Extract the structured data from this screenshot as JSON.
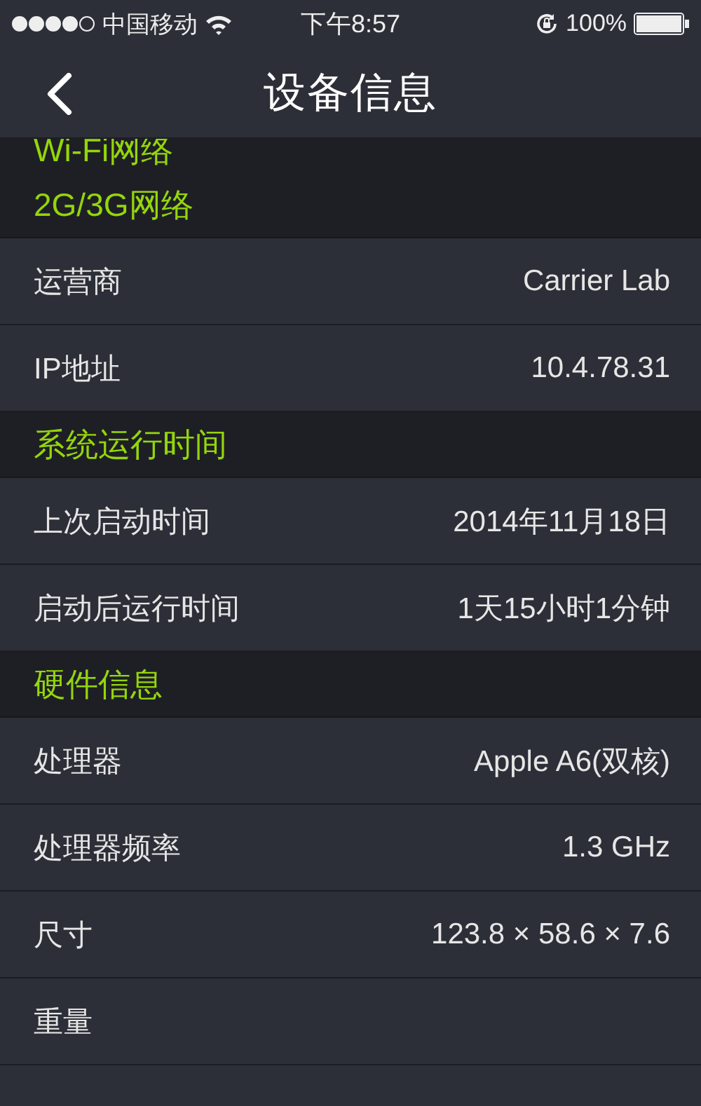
{
  "status_bar": {
    "carrier": "中国移动",
    "time": "下午8:57",
    "battery": "100%"
  },
  "nav": {
    "title": "设备信息"
  },
  "sections": [
    {
      "header": "Wi-Fi网络"
    },
    {
      "header": "2G/3G网络",
      "rows": [
        {
          "label": "运营商",
          "value": "Carrier Lab"
        },
        {
          "label": "IP地址",
          "value": "10.4.78.31"
        }
      ]
    },
    {
      "header": "系统运行时间",
      "rows": [
        {
          "label": "上次启动时间",
          "value": "2014年11月18日"
        },
        {
          "label": "启动后运行时间",
          "value": "1天15小时1分钟"
        }
      ]
    },
    {
      "header": "硬件信息",
      "rows": [
        {
          "label": "处理器",
          "value": "Apple A6(双核)"
        },
        {
          "label": "处理器频率",
          "value": "1.3 GHz"
        },
        {
          "label": "尺寸",
          "value": "123.8 × 58.6 × 7.6"
        },
        {
          "label": "重量"
        }
      ]
    }
  ]
}
